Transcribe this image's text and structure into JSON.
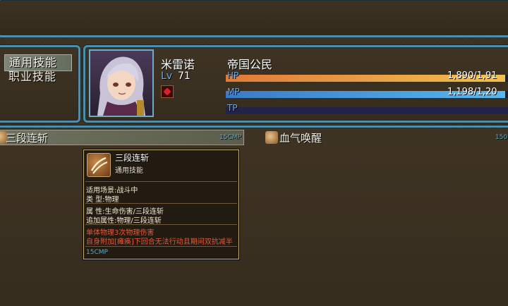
{
  "commands": [
    "通用技能",
    "职业技能"
  ],
  "selected_command": 0,
  "actor": {
    "name": "米雷诺",
    "level_label": "Lv",
    "level": "71",
    "class": "帝国公民",
    "hp_label": "HP",
    "hp_text": "1,890/1,91",
    "hp_ratio": 0.99,
    "mp_label": "MP",
    "mp_text": "1,198/1,20",
    "mp_ratio": 0.99,
    "tp_label": "TP",
    "tp_ratio": 0.0
  },
  "skills": [
    {
      "name": "三段连斩",
      "cost": "15CMP"
    },
    {
      "name": "血气唤醒",
      "cost": "150"
    }
  ],
  "tooltip": {
    "name": "三段连斩",
    "category": "通用技能",
    "scene": "适用场景:战斗中",
    "type": "类    型:物理",
    "attribute": "属    性:生命伤害/三段连斩",
    "extra_attribute": "追加属性:物理/三段连斩",
    "desc1": "单体物理3次物理伤害",
    "desc2": "自身附加[瘫痪]下回合无法行动且期间双抗减半",
    "cost": "15CMP"
  },
  "colors": {
    "hp_bar": "#e8a04a",
    "mp_bar": "#4aa0e0",
    "tp_bar": "#2a2a55",
    "window_border": "#4a8fae",
    "cost_text": "#5fa8c8",
    "desc_text": "#e65a3a"
  }
}
